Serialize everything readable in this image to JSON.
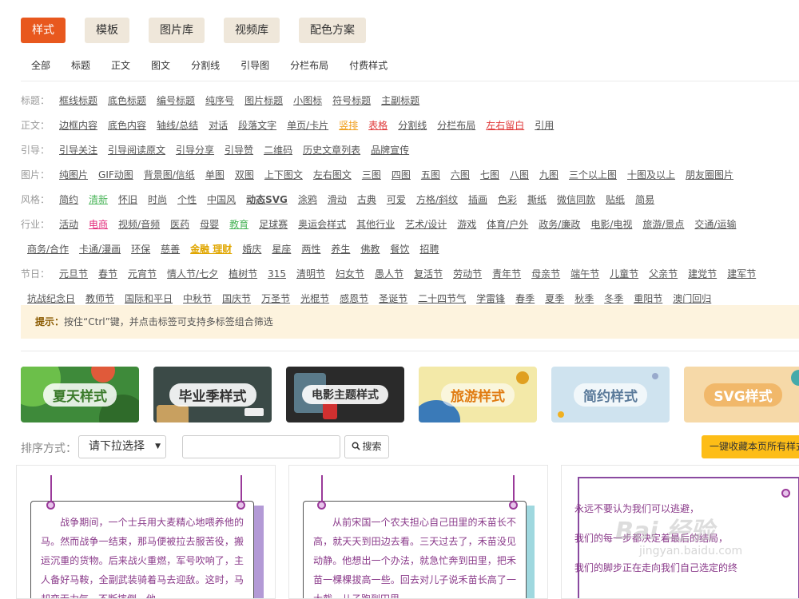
{
  "top_tabs": [
    "样式",
    "模板",
    "图片库",
    "视频库",
    "配色方案"
  ],
  "sub_tabs": [
    "全部",
    "标题",
    "正文",
    "图文",
    "分割线",
    "引导图",
    "分栏布局",
    "付费样式"
  ],
  "filters": {
    "title": {
      "label": "标题：",
      "items": [
        "框线标题",
        "底色标题",
        "编号标题",
        "纯序号",
        "图片标题",
        "小图标",
        "符号标题",
        "主副标题"
      ]
    },
    "body": {
      "label": "正文：",
      "items": [
        "边框内容",
        "底色内容",
        "轴线/总结",
        "对话",
        "段落文字",
        "单页/卡片",
        "竖排",
        "表格",
        "分割线",
        "分栏布局",
        "左右留白",
        "引用"
      ]
    },
    "guide": {
      "label": "引导：",
      "items": [
        "引导关注",
        "引导阅读原文",
        "引导分享",
        "引导赞",
        "二维码",
        "历史文章列表",
        "品牌宣传"
      ]
    },
    "image": {
      "label": "图片：",
      "items": [
        "纯图片",
        "GIF动图",
        "背景图/信纸",
        "单图",
        "双图",
        "上下图文",
        "左右图文",
        "三图",
        "四图",
        "五图",
        "六图",
        "七图",
        "八图",
        "九图",
        "三个以上图",
        "十图及以上",
        "朋友圈图片"
      ]
    },
    "style": {
      "label": "风格：",
      "items": [
        "简约",
        "清新",
        "怀旧",
        "时尚",
        "个性",
        "中国风",
        "动态SVG",
        "涂鸦",
        "滑动",
        "古典",
        "可爱",
        "方格/斜纹",
        "插画",
        "色彩",
        "撕纸",
        "微信同款",
        "贴纸",
        "简易"
      ]
    },
    "industry": {
      "label": "行业：",
      "items": [
        "活动",
        "电商",
        "视频/音频",
        "医药",
        "母婴",
        "教育",
        "足球赛",
        "奥运会样式",
        "其他行业",
        "艺术/设计",
        "游戏",
        "体育/户外",
        "政务/廉政",
        "电影/电视",
        "旅游/景点",
        "交通/运输"
      ]
    },
    "industry2": {
      "items": [
        "商务/合作",
        "卡通/漫画",
        "环保",
        "慈善",
        "金融 理财",
        "婚庆",
        "星座",
        "两性",
        "养生",
        "佛教",
        "餐饮",
        "招聘"
      ]
    },
    "festival": {
      "label": "节日：",
      "items": [
        "元旦节",
        "春节",
        "元宵节",
        "情人节/七夕",
        "植树节",
        "315",
        "清明节",
        "妇女节",
        "愚人节",
        "复活节",
        "劳动节",
        "青年节",
        "母亲节",
        "端午节",
        "儿童节",
        "父亲节",
        "建党节",
        "建军节"
      ]
    },
    "festival2": {
      "items": [
        "抗战纪念日",
        "教师节",
        "国际和平日",
        "中秋节",
        "国庆节",
        "万圣节",
        "光棍节",
        "感恩节",
        "圣诞节",
        "二十四节气",
        "学雷锋",
        "春季",
        "夏季",
        "秋季",
        "冬季",
        "重阳节",
        "澳门回归"
      ]
    }
  },
  "tip": {
    "prefix": "提示：",
    "text": "按住“Ctrl”键，并点击标签可支持多标签组合筛选"
  },
  "banners": [
    "夏天样式",
    "毕业季样式",
    "电影主题样式",
    "旅游样式",
    "简约样式",
    "SVG样式"
  ],
  "sort": {
    "label": "排序方式：",
    "select_value": "请下拉选择",
    "caret": "▼",
    "search_button": "搜索",
    "collect_button": "一键收藏本页所有样式"
  },
  "cards": [
    {
      "text": "战争期间，一个士兵用大麦精心地喂养他的马。然而战争一结束，那马便被拉去服苦役，搬运沉重的货物。后来战火重燃，军号吹响了，主人备好马鞍，全副武装骑着马去迎敌。这时，马却变无力气，不断摔倒，他"
    },
    {
      "text": "从前宋国一个农夫担心自己田里的禾苗长不高，就天天到田边去看。三天过去了，禾苗没见动静。他想出一个办法，就急忙奔到田里，把禾苗一棵棵拔高一些。回去对儿子说禾苗长高了一大截。儿子跑到田里一"
    },
    {
      "lines": [
        "永远不要认为我们可以逃避，",
        "我们的每一步都决定着最后的结局，",
        "我们的脚步正在走向我们自己选定的终"
      ]
    }
  ],
  "watermark": {
    "brand": "Bai 经验",
    "url": "jingyan.baidu.com"
  },
  "colors": {
    "accent": "#e8581e",
    "tab_bg": "#efe7da",
    "tip_bg": "#fdf3de",
    "collect": "#fdbd17",
    "note_text": "#8a3a8a"
  }
}
